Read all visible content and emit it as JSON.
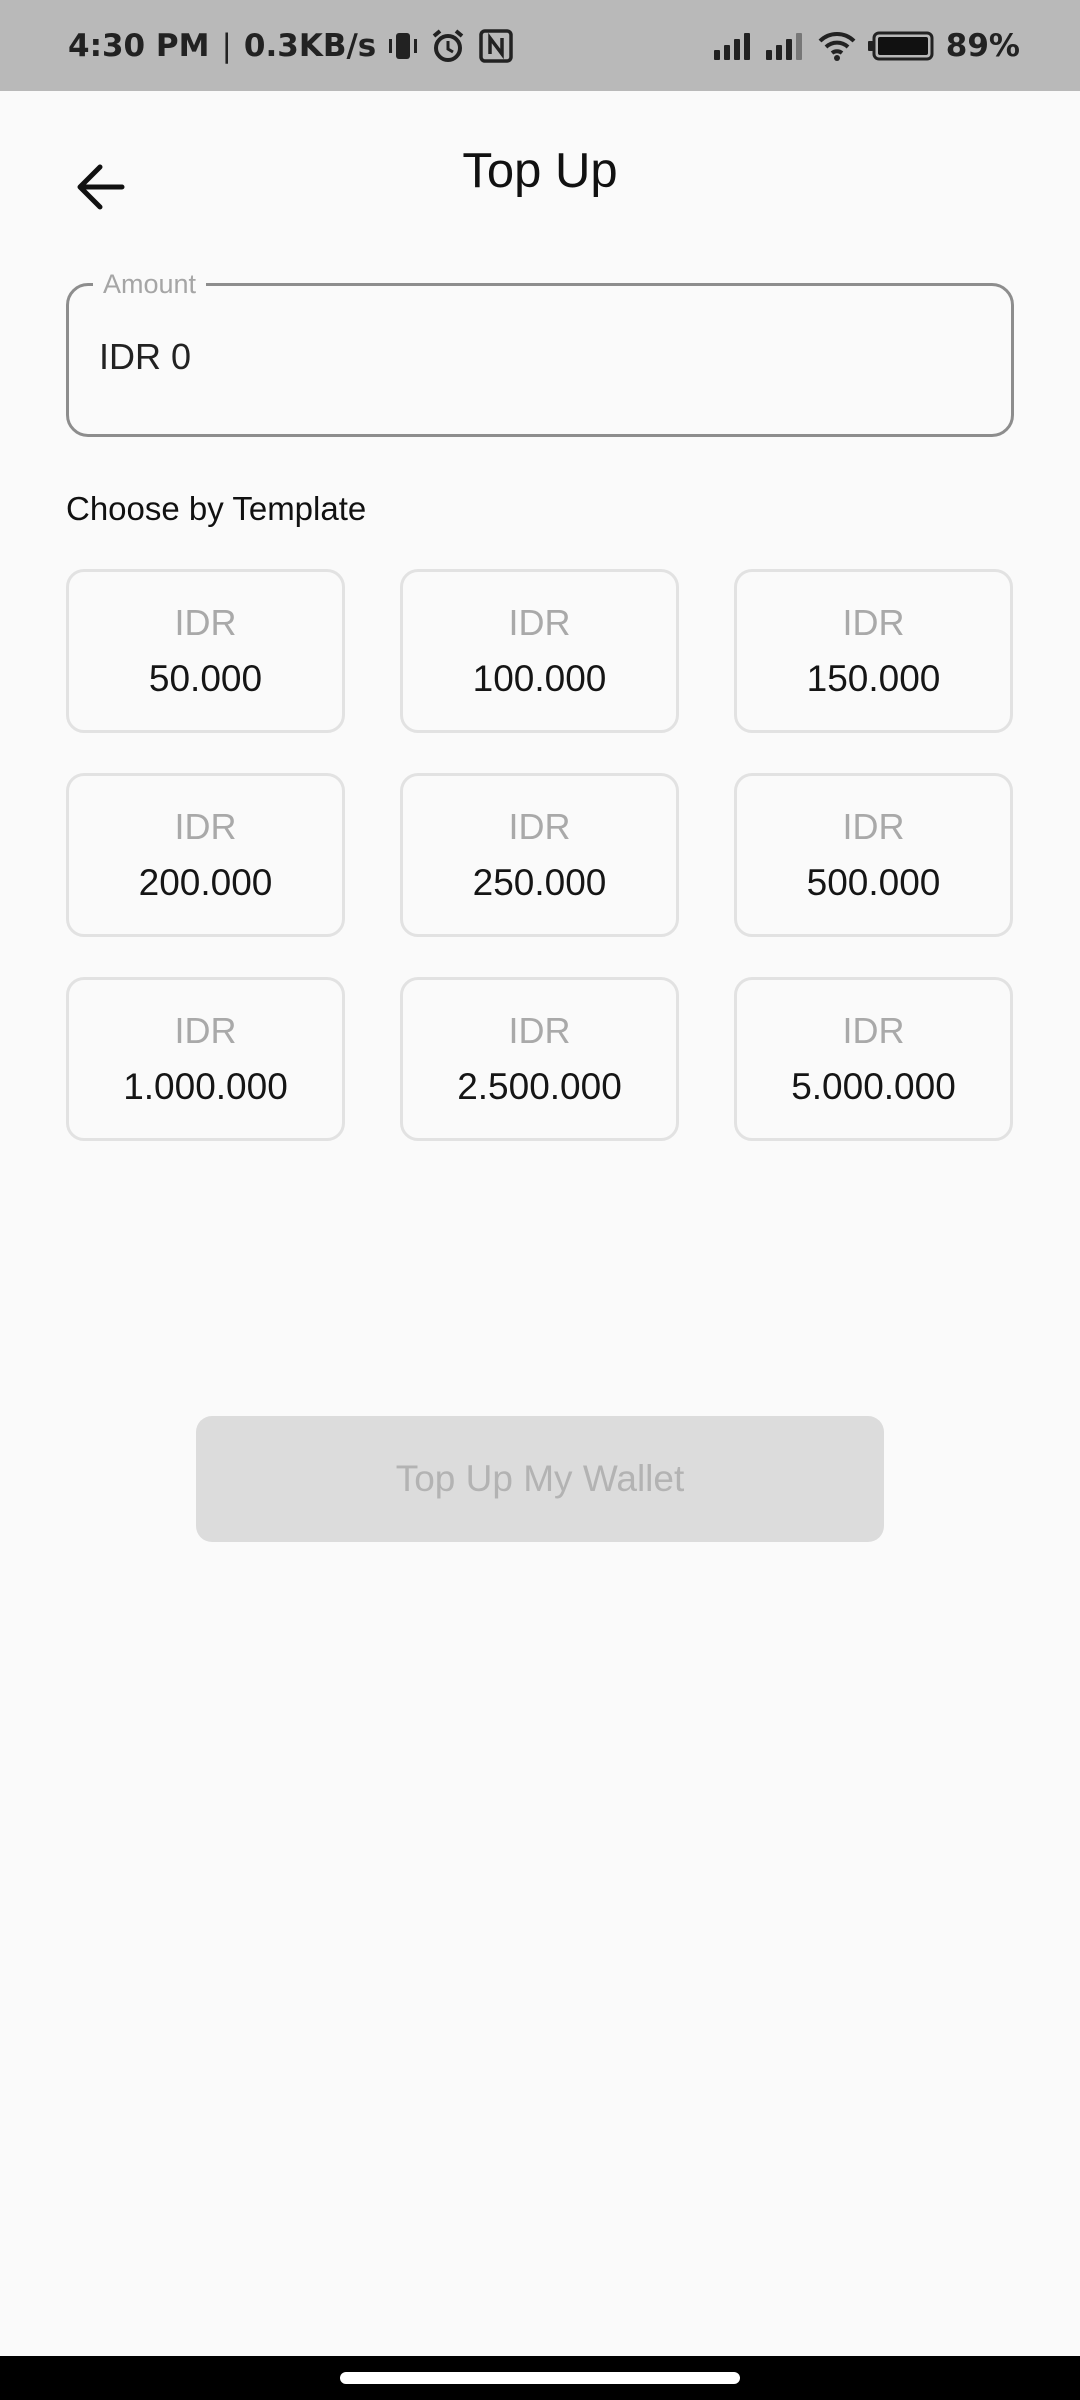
{
  "status_bar": {
    "time": "4:30 PM",
    "separator": "|",
    "net_speed": "0.3KB/s",
    "battery": "89%",
    "icons": [
      "vibrate-icon",
      "alarm-icon",
      "nfc-icon",
      "signal-icon",
      "signal-icon",
      "wifi-icon",
      "battery-icon"
    ]
  },
  "header": {
    "title": "Top Up",
    "back_icon": "arrow-left-icon"
  },
  "amount": {
    "label": "Amount",
    "value": "IDR 0"
  },
  "templates": {
    "label": "Choose by Template",
    "items": [
      {
        "currency": "IDR",
        "amount": "50.000"
      },
      {
        "currency": "IDR",
        "amount": "100.000"
      },
      {
        "currency": "IDR",
        "amount": "150.000"
      },
      {
        "currency": "IDR",
        "amount": "200.000"
      },
      {
        "currency": "IDR",
        "amount": "250.000"
      },
      {
        "currency": "IDR",
        "amount": "500.000"
      },
      {
        "currency": "IDR",
        "amount": "1.000.000"
      },
      {
        "currency": "IDR",
        "amount": "2.500.000"
      },
      {
        "currency": "IDR",
        "amount": "5.000.000"
      }
    ]
  },
  "submit": {
    "label": "Top Up My Wallet"
  },
  "colors": {
    "status_bar": "#b9b9b9",
    "background": "#fafafa",
    "button_disabled": "#dcdcdc",
    "button_text_disabled": "#b3b3b3"
  }
}
